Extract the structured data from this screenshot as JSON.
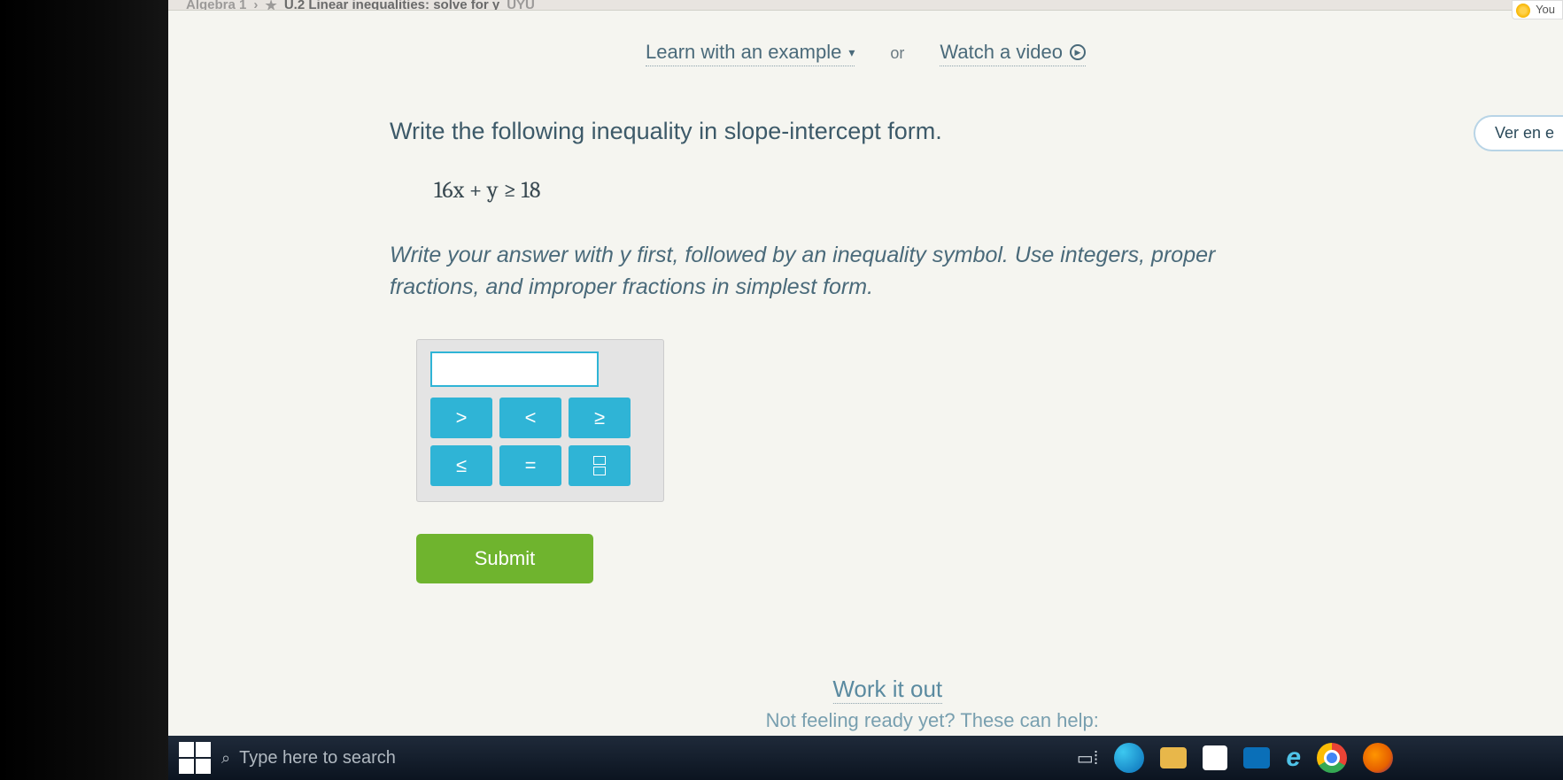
{
  "breadcrumb": {
    "course": "Algebra 1",
    "section": "U.2 Linear inequalities: solve for y",
    "code": "UYU"
  },
  "you_badge": "You",
  "help": {
    "learn": "Learn with an example",
    "or": "or",
    "watch": "Watch a video"
  },
  "language_button": "Ver en e",
  "question": {
    "prompt": "Write the following inequality in slope-intercept form.",
    "equation": "16x + y ≥ 18",
    "instructions": "Write your answer with y first, followed by an inequality symbol. Use integers, proper fractions, and improper fractions in simplest form."
  },
  "keypad": {
    "gt": ">",
    "lt": "<",
    "ge": "≥",
    "le": "≤",
    "eq": "="
  },
  "submit": "Submit",
  "footer": {
    "work_it_out": "Work it out",
    "not_ready": "Not feeling ready yet? These can help:"
  },
  "taskbar": {
    "search_placeholder": "Type here to search"
  }
}
